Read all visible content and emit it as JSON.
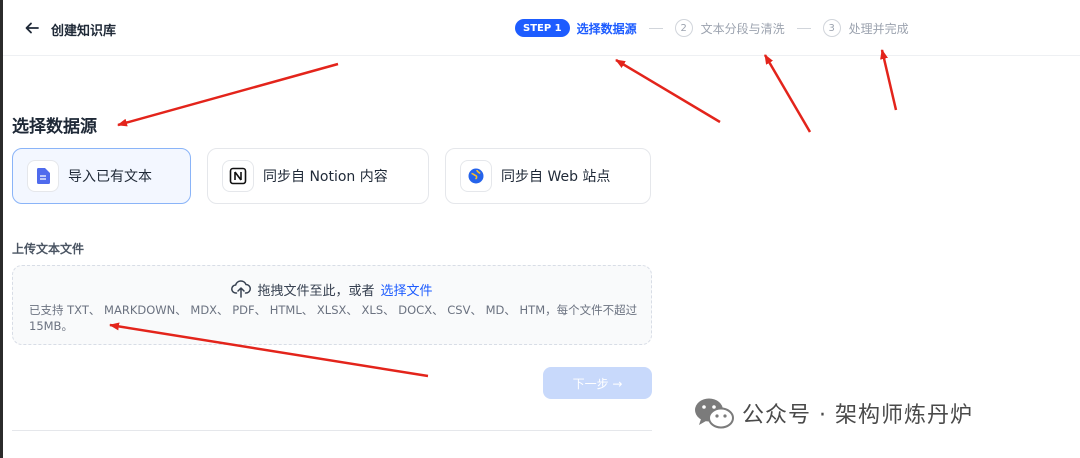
{
  "header": {
    "title": "创建知识库",
    "steps": [
      {
        "badge": "STEP 1",
        "label": "选择数据源",
        "active": true
      },
      {
        "number": "2",
        "label": "文本分段与清洗",
        "active": false
      },
      {
        "number": "3",
        "label": "处理并完成",
        "active": false
      }
    ]
  },
  "main": {
    "section_title": "选择数据源",
    "sources": [
      {
        "label": "导入已有文本",
        "icon": "document-icon",
        "selected": true
      },
      {
        "label": "同步自 Notion 内容",
        "icon": "notion-icon",
        "selected": false
      },
      {
        "label": "同步自 Web 站点",
        "icon": "web-icon",
        "selected": false
      }
    ],
    "upload": {
      "label": "上传文本文件",
      "drop_text": "拖拽文件至此，或者",
      "select_link": "选择文件",
      "hint": "已支持 TXT、 MARKDOWN、 MDX、 PDF、 HTML、 XLSX、 XLS、 DOCX、 CSV、 MD、 HTM，每个文件不超过 15MB。"
    },
    "next_button": "下一步 →"
  },
  "watermark": {
    "text": "公众号 · 架构师炼丹炉"
  },
  "colors": {
    "accent": "#1d5cff",
    "annotation_arrow": "#e3241b"
  }
}
